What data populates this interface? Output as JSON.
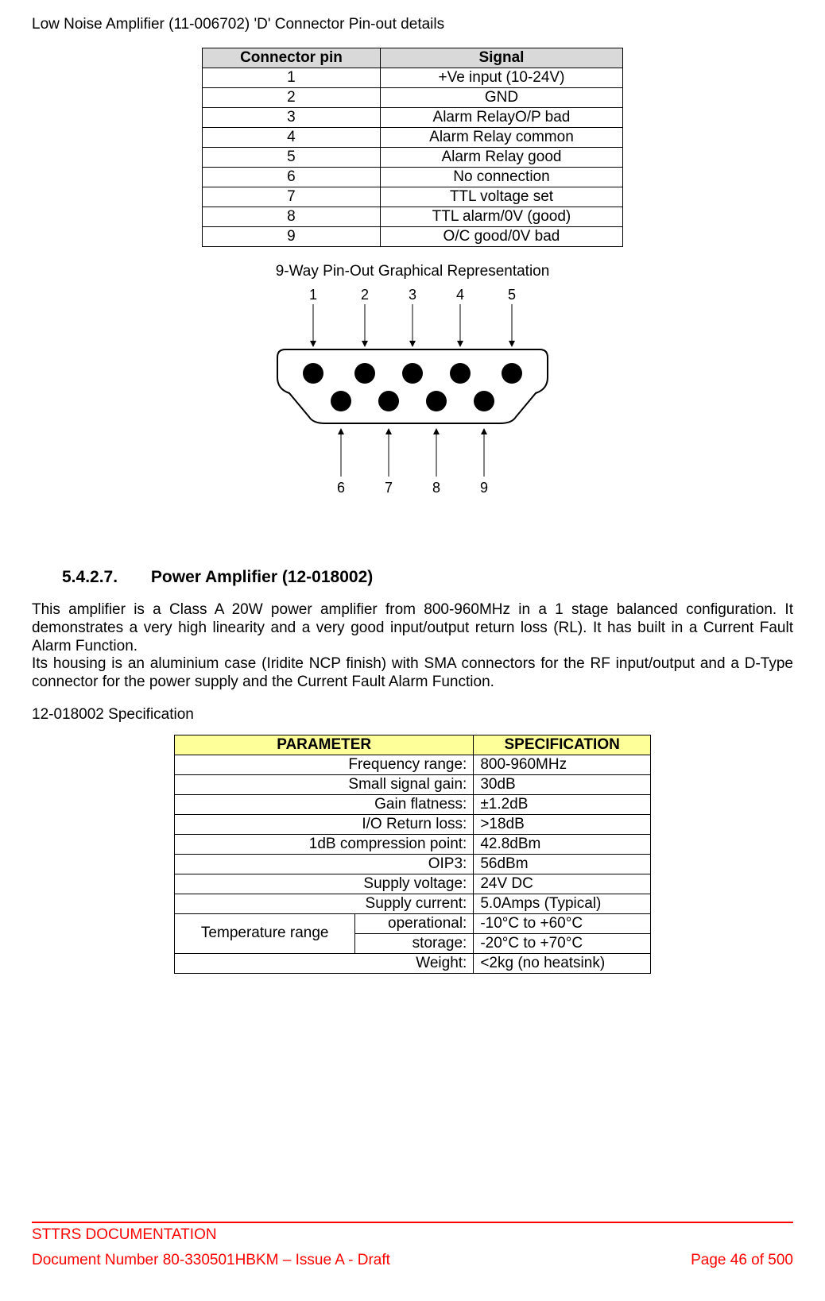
{
  "title": "Low Noise Amplifier (11-006702) 'D' Connector Pin-out details",
  "pinout_table": {
    "headers": {
      "pin": "Connector pin",
      "signal": "Signal"
    },
    "rows": [
      {
        "pin": "1",
        "signal": "+Ve input (10-24V)"
      },
      {
        "pin": "2",
        "signal": "GND"
      },
      {
        "pin": "3",
        "signal": "Alarm RelayO/P bad"
      },
      {
        "pin": "4",
        "signal": "Alarm Relay common"
      },
      {
        "pin": "5",
        "signal": "Alarm Relay good"
      },
      {
        "pin": "6",
        "signal": "No connection"
      },
      {
        "pin": "7",
        "signal": "TTL voltage set"
      },
      {
        "pin": "8",
        "signal": "TTL alarm/0V (good)"
      },
      {
        "pin": "9",
        "signal": "O/C good/0V bad"
      }
    ]
  },
  "diagram": {
    "caption": "9-Way Pin-Out Graphical Representation",
    "top_labels": [
      "1",
      "2",
      "3",
      "4",
      "5"
    ],
    "bottom_labels": [
      "6",
      "7",
      "8",
      "9"
    ]
  },
  "section": {
    "number": "5.4.2.7.",
    "title": "Power Amplifier (12-018002)"
  },
  "paragraph1": "This amplifier is a Class A 20W power amplifier from 800-960MHz in a 1 stage balanced configuration. It demonstrates a very high linearity and a very good input/output return loss (RL). It has built in a Current Fault Alarm Function.",
  "paragraph2": "Its housing is an aluminium case (Iridite NCP finish) with SMA connectors for the RF input/output and a D-Type connector for the power supply and the Current Fault Alarm Function.",
  "spec_label": "12-018002 Specification",
  "spec_table": {
    "headers": {
      "param": "PARAMETER",
      "spec": "SPECIFICATION"
    },
    "rows": [
      {
        "param": "Frequency range:",
        "spec": "800-960MHz"
      },
      {
        "param": "Small signal gain:",
        "spec": "30dB"
      },
      {
        "param": "Gain flatness:",
        "spec": "±1.2dB"
      },
      {
        "param": "I/O Return loss:",
        "spec": ">18dB"
      },
      {
        "param": "1dB compression point:",
        "spec": "42.8dBm"
      },
      {
        "param": "OIP3:",
        "spec": "56dBm"
      },
      {
        "param": "Supply voltage:",
        "spec": "24V DC"
      },
      {
        "param": "Supply current:",
        "spec": "5.0Amps (Typical)"
      }
    ],
    "temp_group_label": "Temperature range",
    "temp_rows": [
      {
        "param": "operational:",
        "spec": "-10°C to +60°C"
      },
      {
        "param": "storage:",
        "spec": "-20°C to +70°C"
      }
    ],
    "weight": {
      "param": "Weight:",
      "spec": "<2kg (no heatsink)"
    }
  },
  "chart_data": {
    "type": "table",
    "title": "12-018002 Specification",
    "columns": [
      "PARAMETER",
      "SPECIFICATION"
    ],
    "rows": [
      [
        "Frequency range:",
        "800-960MHz"
      ],
      [
        "Small signal gain:",
        "30dB"
      ],
      [
        "Gain flatness:",
        "±1.2dB"
      ],
      [
        "I/O Return loss:",
        ">18dB"
      ],
      [
        "1dB compression point:",
        "42.8dBm"
      ],
      [
        "OIP3:",
        "56dBm"
      ],
      [
        "Supply voltage:",
        "24V DC"
      ],
      [
        "Supply current:",
        "5.0Amps (Typical)"
      ],
      [
        "Temperature range operational:",
        "-10°C to +60°C"
      ],
      [
        "Temperature range storage:",
        "-20°C to +70°C"
      ],
      [
        "Weight:",
        "<2kg (no heatsink)"
      ]
    ]
  },
  "footer": {
    "org": "STTRS DOCUMENTATION",
    "docnum": "Document Number 80-330501HBKM – Issue A - Draft",
    "page": "Page 46 of 500"
  }
}
